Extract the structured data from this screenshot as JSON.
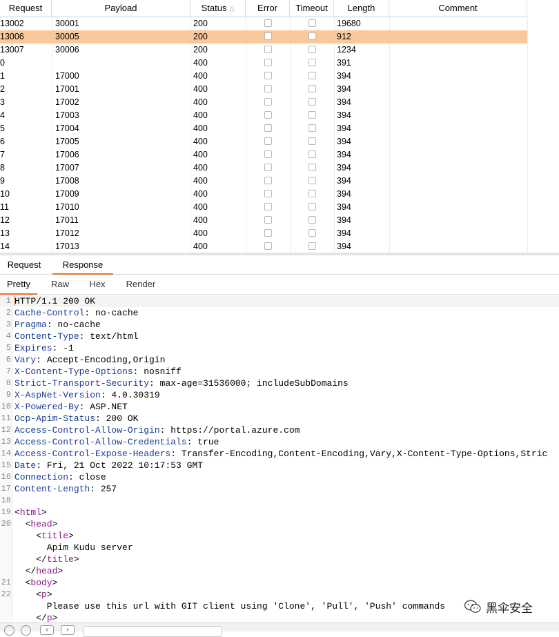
{
  "table": {
    "headers": {
      "request": "Request",
      "payload": "Payload",
      "status": "Status",
      "error": "Error",
      "timeout": "Timeout",
      "length": "Length",
      "comment": "Comment"
    },
    "sort": {
      "column": "status",
      "direction": "ascending"
    },
    "selected_index": 1,
    "rows": [
      {
        "request": "13002",
        "payload": "30001",
        "status": "200",
        "length": "19680"
      },
      {
        "request": "13006",
        "payload": "30005",
        "status": "200",
        "length": "912"
      },
      {
        "request": "13007",
        "payload": "30006",
        "status": "200",
        "length": "1234"
      },
      {
        "request": "0",
        "payload": "",
        "status": "400",
        "length": "391"
      },
      {
        "request": "1",
        "payload": "17000",
        "status": "400",
        "length": "394"
      },
      {
        "request": "2",
        "payload": "17001",
        "status": "400",
        "length": "394"
      },
      {
        "request": "3",
        "payload": "17002",
        "status": "400",
        "length": "394"
      },
      {
        "request": "4",
        "payload": "17003",
        "status": "400",
        "length": "394"
      },
      {
        "request": "5",
        "payload": "17004",
        "status": "400",
        "length": "394"
      },
      {
        "request": "6",
        "payload": "17005",
        "status": "400",
        "length": "394"
      },
      {
        "request": "7",
        "payload": "17006",
        "status": "400",
        "length": "394"
      },
      {
        "request": "8",
        "payload": "17007",
        "status": "400",
        "length": "394"
      },
      {
        "request": "9",
        "payload": "17008",
        "status": "400",
        "length": "394"
      },
      {
        "request": "10",
        "payload": "17009",
        "status": "400",
        "length": "394"
      },
      {
        "request": "11",
        "payload": "17010",
        "status": "400",
        "length": "394"
      },
      {
        "request": "12",
        "payload": "17011",
        "status": "400",
        "length": "394"
      },
      {
        "request": "13",
        "payload": "17012",
        "status": "400",
        "length": "394"
      },
      {
        "request": "14",
        "payload": "17013",
        "status": "400",
        "length": "394"
      }
    ]
  },
  "message_tabs": {
    "request": "Request",
    "response": "Response",
    "active": "response"
  },
  "view_tabs": {
    "pretty": "Pretty",
    "raw": "Raw",
    "hex": "Hex",
    "render": "Render",
    "active": "pretty"
  },
  "response_lines": [
    {
      "n": "1",
      "segments": [
        {
          "t": "HTTP/1.1 200 OK",
          "c": "hv"
        }
      ]
    },
    {
      "n": "2",
      "segments": [
        {
          "t": "Cache-Control",
          "c": "hk"
        },
        {
          "t": ": no-cache",
          "c": "hv"
        }
      ]
    },
    {
      "n": "3",
      "segments": [
        {
          "t": "Pragma",
          "c": "hk"
        },
        {
          "t": ": no-cache",
          "c": "hv"
        }
      ]
    },
    {
      "n": "4",
      "segments": [
        {
          "t": "Content-Type",
          "c": "hk"
        },
        {
          "t": ": text/html",
          "c": "hv"
        }
      ]
    },
    {
      "n": "5",
      "segments": [
        {
          "t": "Expires",
          "c": "hk"
        },
        {
          "t": ": -1",
          "c": "hv"
        }
      ]
    },
    {
      "n": "6",
      "segments": [
        {
          "t": "Vary",
          "c": "hk"
        },
        {
          "t": ": Accept-Encoding,Origin",
          "c": "hv"
        }
      ]
    },
    {
      "n": "7",
      "segments": [
        {
          "t": "X-Content-Type-Options",
          "c": "hk"
        },
        {
          "t": ": nosniff",
          "c": "hv"
        }
      ]
    },
    {
      "n": "8",
      "segments": [
        {
          "t": "Strict-Transport-Security",
          "c": "hk"
        },
        {
          "t": ": max-age=31536000; includeSubDomains",
          "c": "hv"
        }
      ]
    },
    {
      "n": "9",
      "segments": [
        {
          "t": "X-AspNet-Version",
          "c": "hk"
        },
        {
          "t": ": 4.0.30319",
          "c": "hv"
        }
      ]
    },
    {
      "n": "10",
      "segments": [
        {
          "t": "X-Powered-By",
          "c": "hk"
        },
        {
          "t": ": ASP.NET",
          "c": "hv"
        }
      ]
    },
    {
      "n": "11",
      "segments": [
        {
          "t": "Ocp-Apim-Status",
          "c": "hk"
        },
        {
          "t": ": 200 OK",
          "c": "hv"
        }
      ]
    },
    {
      "n": "12",
      "segments": [
        {
          "t": "Access-Control-Allow-Origin",
          "c": "hk"
        },
        {
          "t": ": https://portal.azure.com",
          "c": "hv"
        }
      ]
    },
    {
      "n": "13",
      "segments": [
        {
          "t": "Access-Control-Allow-Credentials",
          "c": "hk"
        },
        {
          "t": ": true",
          "c": "hv"
        }
      ]
    },
    {
      "n": "14",
      "segments": [
        {
          "t": "Access-Control-Expose-Headers",
          "c": "hk"
        },
        {
          "t": ": Transfer-Encoding,Content-Encoding,Vary,X-Content-Type-Options,Stric",
          "c": "hv"
        }
      ]
    },
    {
      "n": "15",
      "segments": [
        {
          "t": "Date",
          "c": "hk"
        },
        {
          "t": ": Fri, 21 Oct 2022 10:17:53 GMT",
          "c": "hv"
        }
      ]
    },
    {
      "n": "16",
      "segments": [
        {
          "t": "Connection",
          "c": "hk"
        },
        {
          "t": ": close",
          "c": "hv"
        }
      ]
    },
    {
      "n": "17",
      "segments": [
        {
          "t": "Content-Length",
          "c": "hk"
        },
        {
          "t": ": 257",
          "c": "hv"
        }
      ]
    },
    {
      "n": "18",
      "segments": []
    },
    {
      "n": "19",
      "segments": [
        {
          "t": "<",
          "c": "hv"
        },
        {
          "t": "html",
          "c": "tag"
        },
        {
          "t": ">",
          "c": "hv"
        }
      ]
    },
    {
      "n": "20",
      "segments": [
        {
          "t": "  <",
          "c": "hv"
        },
        {
          "t": "head",
          "c": "tag"
        },
        {
          "t": ">",
          "c": "hv"
        }
      ]
    },
    {
      "n": "",
      "segments": [
        {
          "t": "    <",
          "c": "hv"
        },
        {
          "t": "title",
          "c": "tag"
        },
        {
          "t": ">",
          "c": "hv"
        }
      ]
    },
    {
      "n": "",
      "segments": [
        {
          "t": "      Apim Kudu server",
          "c": "hv"
        }
      ]
    },
    {
      "n": "",
      "segments": [
        {
          "t": "    </",
          "c": "hv"
        },
        {
          "t": "title",
          "c": "tag"
        },
        {
          "t": ">",
          "c": "hv"
        }
      ]
    },
    {
      "n": "",
      "segments": [
        {
          "t": "  </",
          "c": "hv"
        },
        {
          "t": "head",
          "c": "tag"
        },
        {
          "t": ">",
          "c": "hv"
        }
      ]
    },
    {
      "n": "21",
      "segments": [
        {
          "t": "  <",
          "c": "hv"
        },
        {
          "t": "body",
          "c": "tag"
        },
        {
          "t": ">",
          "c": "hv"
        }
      ]
    },
    {
      "n": "22",
      "segments": [
        {
          "t": "    <",
          "c": "hv"
        },
        {
          "t": "p",
          "c": "tag"
        },
        {
          "t": ">",
          "c": "hv"
        }
      ]
    },
    {
      "n": "",
      "segments": [
        {
          "t": "      Please use this url with GIT client using 'Clone', 'Pull', 'Push' commands",
          "c": "hv"
        }
      ]
    },
    {
      "n": "",
      "segments": [
        {
          "t": "    </",
          "c": "hv"
        },
        {
          "t": "p",
          "c": "tag"
        },
        {
          "t": ">",
          "c": "hv"
        }
      ]
    }
  ],
  "watermark": {
    "text": "黑伞安全"
  },
  "icons": {
    "help": "help-icon",
    "settings": "gear-icon",
    "back": "arrow-left-icon",
    "forward": "arrow-right-icon",
    "wechat": "wechat-logo-icon"
  },
  "colors": {
    "selection": "#f9c89b",
    "accent": "#e8702a",
    "header_key": "#1a3d93",
    "tag": "#8b1a8b"
  }
}
